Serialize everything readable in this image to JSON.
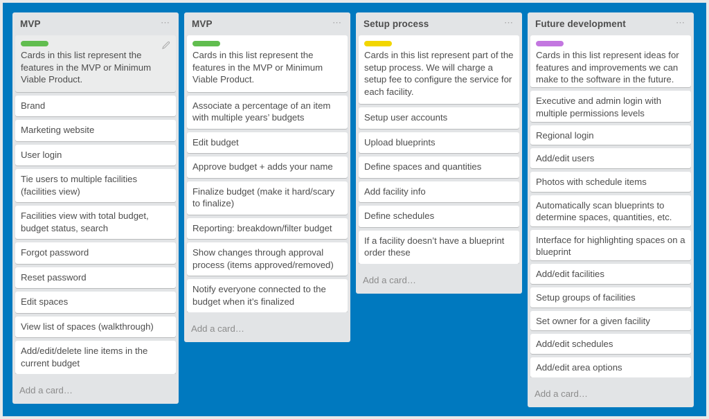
{
  "board": {
    "background_color": "#0079bf",
    "list_background_color": "#e2e4e6",
    "card_background_color": "#ffffff",
    "menu_icon": "⋯",
    "lists": [
      {
        "title": "MVP",
        "menu_label": "list-actions",
        "add_card_label": "Add a card…",
        "description_card": {
          "label_color": "#61bd4f",
          "label_name": "green-label",
          "text": "Cards in this list represent the features in the MVP or Minimum Viable Product.",
          "has_edit_pencil": true,
          "hovered": true
        },
        "cards": [
          "Brand",
          "Marketing website",
          "User login",
          "Tie users to multiple facilities (facilities view)",
          "Facilities view with total budget, budget status, search",
          "Forgot password",
          "Reset password",
          "Edit spaces",
          "View list of spaces (walkthrough)",
          "Add/edit/delete line items in the current budget"
        ]
      },
      {
        "title": "MVP",
        "menu_label": "list-actions",
        "add_card_label": "Add a card…",
        "description_card": {
          "label_color": "#61bd4f",
          "label_name": "green-label",
          "text": "Cards in this list represent the features in the MVP or Minimum Viable Product.",
          "has_edit_pencil": false,
          "hovered": false
        },
        "cards": [
          "Associate a percentage of an item with multiple years’ budgets",
          "Edit budget",
          "Approve budget + adds your name",
          "Finalize budget (make it hard/scary to finalize)",
          "Reporting: breakdown/filter budget",
          "Show changes through approval process (items approved/removed)",
          "Notify everyone connected to the budget when it’s finalized"
        ]
      },
      {
        "title": "Setup process",
        "menu_label": "list-actions",
        "add_card_label": "Add a card…",
        "description_card": {
          "label_color": "#f2d600",
          "label_name": "yellow-label",
          "text": "Cards in this list represent part of the setup process. We will charge a setup fee to configure the service for each facility.",
          "has_edit_pencil": false,
          "hovered": false
        },
        "cards": [
          "Setup user accounts",
          "Upload blueprints",
          "Define spaces and quantities",
          "Add facility info",
          "Define schedules",
          "If a facility doesn’t have a blueprint order these"
        ]
      },
      {
        "title": "Future development",
        "menu_label": "list-actions",
        "add_card_label": "Add a card…",
        "description_card": {
          "label_color": "#c377e0",
          "label_name": "purple-label",
          "text": "Cards in this list represent ideas for features and improvements we can make to the software in the future.",
          "has_edit_pencil": false,
          "hovered": false
        },
        "cards": [
          "Executive and admin login with multiple permissions levels",
          "Regional login",
          "Add/edit users",
          "Photos with schedule items",
          "Automatically scan blueprints to determine spaces, quantities, etc.",
          "Interface for highlighting spaces on a blueprint",
          "Add/edit facilities",
          "Setup groups of facilities",
          "Set owner for a given facility",
          "Add/edit schedules",
          "Add/edit area options"
        ]
      }
    ]
  }
}
